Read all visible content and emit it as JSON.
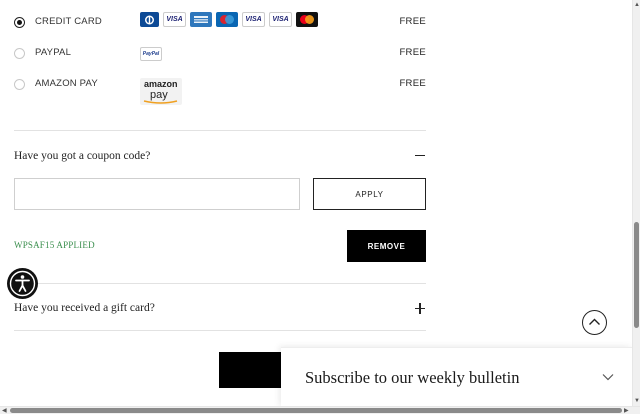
{
  "payment": {
    "methods": [
      {
        "label": "CREDIT CARD",
        "price": "FREE",
        "selected": true
      },
      {
        "label": "PAYPAL",
        "price": "FREE",
        "selected": false
      },
      {
        "label": "AMAZON PAY",
        "price": "FREE",
        "selected": false
      }
    ],
    "card_logos": [
      "VISA",
      "VISA",
      "VISA"
    ],
    "paypal_logo": "PayPal",
    "amazon_logo": {
      "line1": "amazon",
      "line2": "pay"
    }
  },
  "coupon": {
    "title": "Have you got a coupon code?",
    "input_value": "",
    "apply_label": "APPLY",
    "applied_text": "WPSAF15 APPLIED",
    "remove_label": "REMOVE",
    "expanded": true
  },
  "gift_card": {
    "title": "Have you received a gift card?",
    "expanded": false
  },
  "bulletin": {
    "text": "Subscribe to our weekly bulletin"
  },
  "icons": {
    "accessibility": "accessibility-icon",
    "scroll_top": "chevron-up-icon",
    "bulletin_toggle": "chevron-down-icon"
  },
  "colors": {
    "applied_green": "#3b8f4e",
    "button_black": "#000000"
  }
}
